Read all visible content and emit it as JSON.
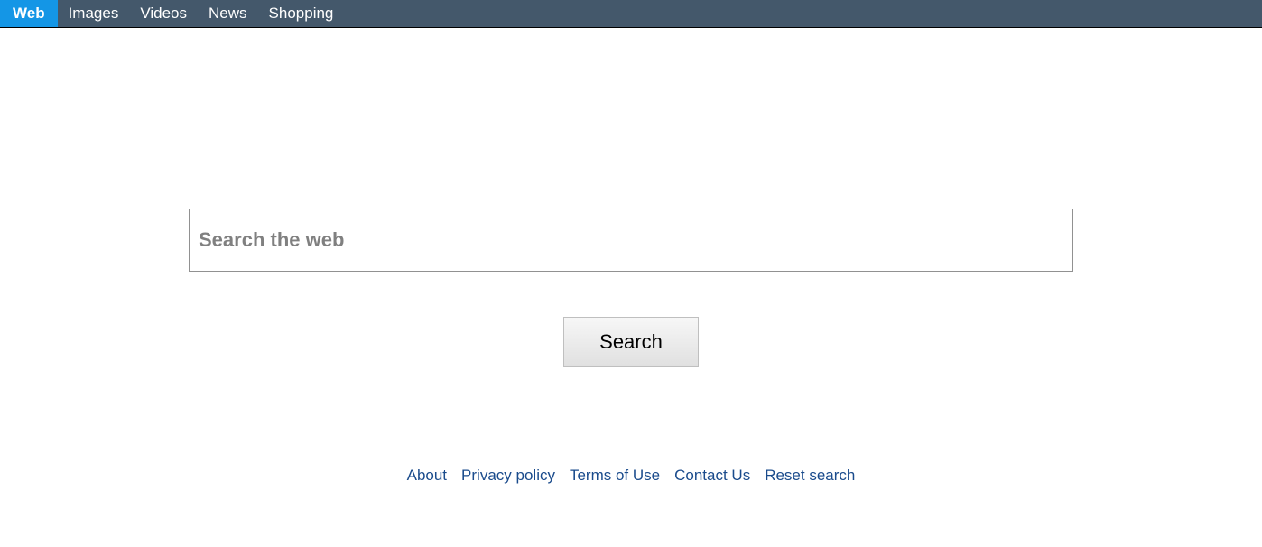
{
  "nav": {
    "items": [
      {
        "label": "Web",
        "active": true
      },
      {
        "label": "Images",
        "active": false
      },
      {
        "label": "Videos",
        "active": false
      },
      {
        "label": "News",
        "active": false
      },
      {
        "label": "Shopping",
        "active": false
      }
    ]
  },
  "search": {
    "placeholder": "Search the web",
    "value": "",
    "button_label": "Search"
  },
  "footer": {
    "links": [
      {
        "label": "About"
      },
      {
        "label": "Privacy policy"
      },
      {
        "label": "Terms of Use"
      },
      {
        "label": "Contact Us"
      },
      {
        "label": "Reset search"
      }
    ]
  }
}
